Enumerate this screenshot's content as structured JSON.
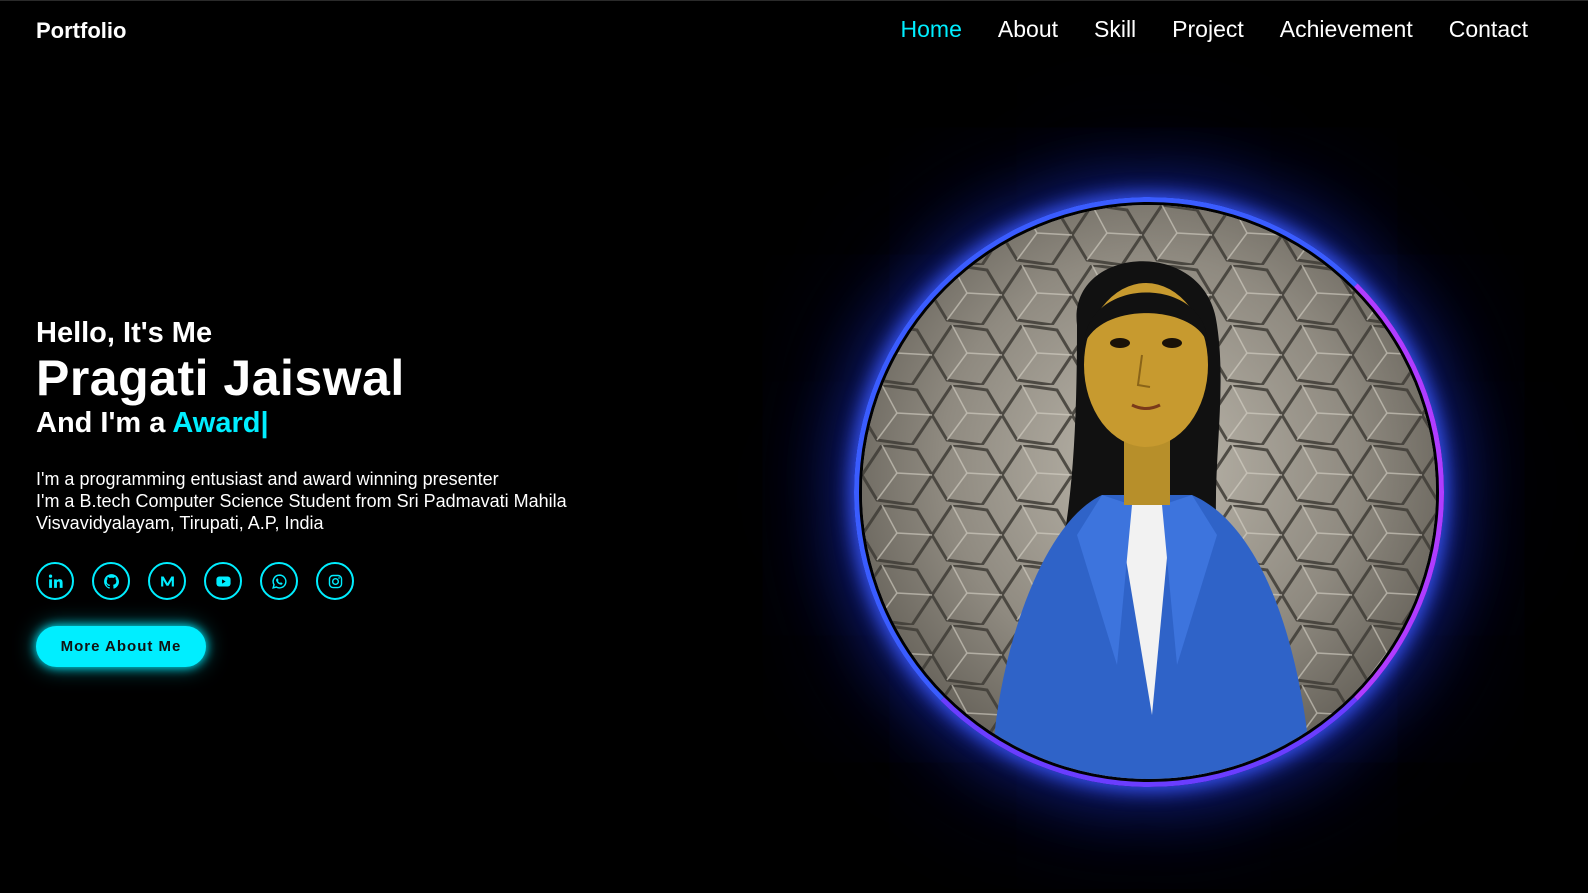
{
  "header": {
    "logo": "Portfolio",
    "nav": [
      {
        "label": "Home",
        "active": true
      },
      {
        "label": "About",
        "active": false
      },
      {
        "label": "Skill",
        "active": false
      },
      {
        "label": "Project",
        "active": false
      },
      {
        "label": "Achievement",
        "active": false
      },
      {
        "label": "Contact",
        "active": false
      }
    ]
  },
  "hero": {
    "greeting": "Hello, It's Me",
    "name": "Pragati Jaiswal",
    "role_prefix": "And I'm a ",
    "role_typed": "Award|",
    "description": [
      "I'm a programming entusiast and award winning presenter",
      "I'm a B.tech Computer Science Student from Sri Padmavati Mahila",
      "Visvavidyalayam, Tirupati, A.P, India"
    ],
    "socials": [
      "linkedin-icon",
      "github-icon",
      "medium-icon",
      "youtube-icon",
      "whatsapp-icon",
      "instagram-icon"
    ],
    "cta_label": "More About Me"
  },
  "theme": {
    "accent": "#00eeff",
    "background": "#000000"
  }
}
